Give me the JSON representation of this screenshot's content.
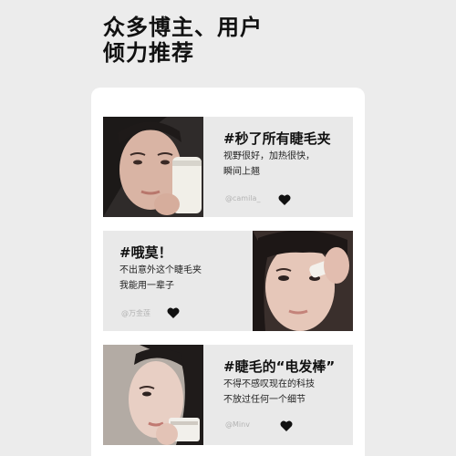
{
  "headline": {
    "line1": "众多博主、用户",
    "line2": "倾力推荐"
  },
  "cards": [
    {
      "title": "#秒了所有睫毛夹",
      "desc_line1": "视野很好，加热很快，",
      "desc_line2": "瞬间上翘",
      "handle": "@camila_",
      "heart_icon": "heart-icon"
    },
    {
      "title": "#哦莫！",
      "desc_line1": "不出意外这个睫毛夹",
      "desc_line2": "我能用一辈子",
      "handle": "@万金莲",
      "heart_icon": "heart-icon"
    },
    {
      "title": "#睫毛的“电发棒”",
      "desc_line1": "不得不感叹现在的科技",
      "desc_line2": "不放过任何一个细节",
      "handle": "@Minv",
      "heart_icon": "heart-icon"
    }
  ]
}
